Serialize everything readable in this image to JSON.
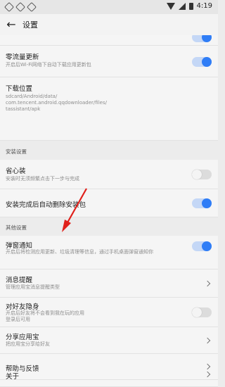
{
  "status_bar": {
    "time": "4:19"
  },
  "appbar": {
    "title": "设置"
  },
  "rows": {
    "zero_traffic_update": {
      "title": "零流量更新",
      "subtitle": "开启后Wi-Fi网络下自动下载应用更新包"
    },
    "download_location": {
      "title": "下载位置",
      "subtitle": "sdcard/Android/data/\ncom.tencent.android.qqdownloader/files/\ntassistant/apk"
    },
    "save_effort_install": {
      "title": "省心装",
      "subtitle": "安装时无须频繁点击下一步与完成"
    },
    "auto_delete_package": {
      "title": "安装完成后自动删除安装包"
    },
    "popup_notification": {
      "title": "弹窗通知",
      "subtitle": "开启后将检测应用更新、垃圾清理等信息，通过手机桌面弹窗通知你"
    },
    "message_reminder": {
      "title": "消息提醒",
      "subtitle": "管理应用宝消息提醒类型"
    },
    "friends_invisible": {
      "title": "对好友隐身",
      "subtitle": "开启后好友将不会看到我在玩的应用\n登录后可用"
    },
    "share_app": {
      "title": "分享应用宝",
      "subtitle": "把应用宝分享给好友"
    },
    "help_feedback": {
      "title": "帮助与反馈"
    },
    "about": {
      "title": "关于"
    }
  },
  "sections": {
    "install_settings": "安装设置",
    "other_settings": "其他设置"
  },
  "toggles": {
    "zero_traffic_update": true,
    "save_effort_install": false,
    "auto_delete_package": true,
    "popup_notification": true,
    "friends_invisible": false
  },
  "colors": {
    "accent": "#2f7df6",
    "annotation_arrow": "#e0201b"
  }
}
